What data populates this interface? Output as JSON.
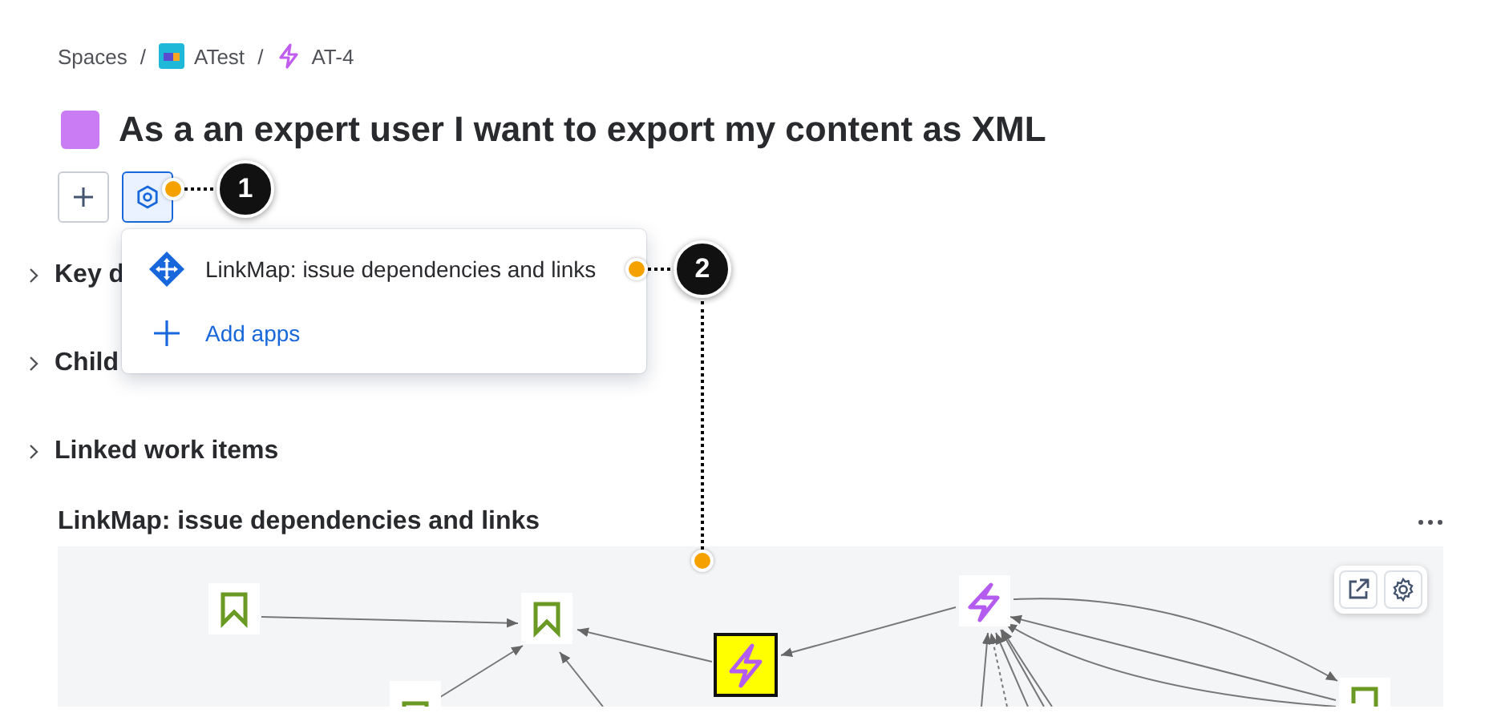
{
  "breadcrumb": {
    "separator": "/",
    "items": [
      {
        "label": "Spaces",
        "kind": "plain"
      },
      {
        "label": "ATest",
        "kind": "project"
      },
      {
        "label": "AT-4",
        "kind": "issue"
      }
    ]
  },
  "issue": {
    "title": "As a an expert user I want to export my content as XML",
    "color": "#c97cf4"
  },
  "toolbar": [
    {
      "kind": "add",
      "selected": false
    },
    {
      "kind": "apps",
      "selected": true
    }
  ],
  "sections": [
    {
      "label": "Key d",
      "expanded": false
    },
    {
      "label": "Child",
      "expanded": false
    },
    {
      "label": "Linked work items",
      "expanded": false
    }
  ],
  "apps_menu": {
    "items": [
      {
        "kind": "app",
        "label": "LinkMap: issue dependencies and links"
      },
      {
        "kind": "add",
        "label": "Add apps"
      }
    ]
  },
  "callouts": [
    {
      "number": "1"
    },
    {
      "number": "2"
    }
  ],
  "linkmap": {
    "title": "LinkMap: issue dependencies and links"
  }
}
